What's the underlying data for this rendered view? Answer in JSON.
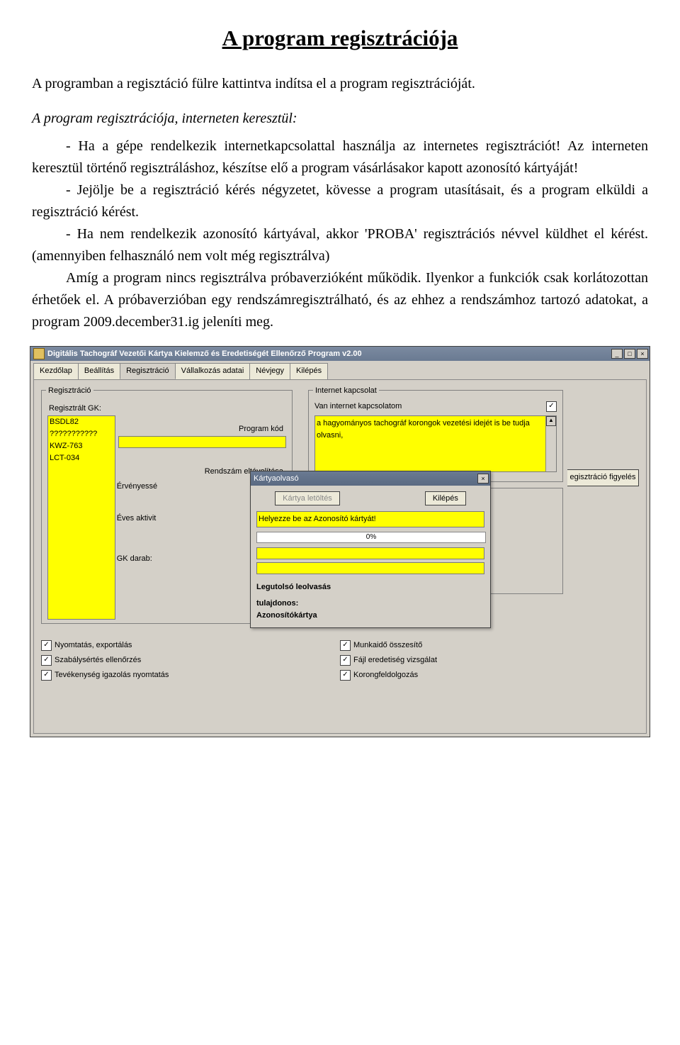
{
  "doc": {
    "title": "A program regisztrációja",
    "intro": "A programban a regisztáció fülre kattintva indítsa el a program regisztrációját.",
    "subTitle": "A program regisztrációja, interneten keresztül:",
    "p1": "- Ha a gépe rendelkezik internetkapcsolattal használja az internetes regisztrációt! Az interneten keresztül történő regisztráláshoz, készítse elő a program vásárlásakor kapott azonosító kártyáját!",
    "p2": "- Jejölje be a regisztráció kérés négyzetet, kövesse a program utasításait, és a program elküldi a regisztráció kérést.",
    "p3": "- Ha nem rendelkezik azonosító kártyával, akkor 'PROBA' regisztrációs névvel küldhet el kérést. (amennyiben felhasználó nem volt még regisztrálva)",
    "p4": "Amíg a program nincs regisztrálva próbaverzióként működik. Ilyenkor a funkciók csak korlátozottan érhetőek el. A próbaverzióban egy rendszámregisztrálható, és az ehhez a rendszámhoz tartozó adatokat, a program 2009.december31.ig jeleníti meg."
  },
  "window": {
    "title": "Digitális Tachográf Vezetői Kártya Kielemző és Eredetiségét Ellenőrző Program  v2.00",
    "tabs": [
      "Kezdőlap",
      "Beállítás",
      "Regisztráció",
      "Vállalkozás adatai",
      "Névjegy",
      "Kilépés"
    ],
    "activeTab": 2,
    "regBox": {
      "legend": "Regisztráció",
      "label1": "Regisztrált GK:",
      "listItems": [
        "BSDL82",
        "???????????",
        "KWZ-763",
        "LCT-034"
      ],
      "labProgramCode": "Program kód",
      "labRemovePlate": "Rendszám eltávolítása",
      "labValidate": "Érvényessé",
      "labActivation": "Éves aktivit",
      "labGkCount": "GK darab:"
    },
    "netBox": {
      "legend": "Internet kapcsolat",
      "hasInternet": "Van internet kapcsolatom",
      "textArea": "a hagyományos tachográf korongok vezetési idejét is be tudja olvasni,"
    },
    "peekButton": "egisztráció figyelés",
    "checksLeft": [
      "Nyomtatás, exportálás",
      "Szabálysértés ellenőrzés",
      "Tevékenység igazolás nyomtatás"
    ],
    "checksRight": [
      "Munkaidő összesítő",
      "Fájl eredetiség vizsgálat",
      "Korongfeldolgozás"
    ]
  },
  "modal": {
    "title": "Kártyaolvasó",
    "btnDownload": "Kártya letöltés",
    "btnExit": "Kilépés",
    "hint": "Helyezze be az Azonosító kártyát!",
    "progress": "0%",
    "line1": "Legutolsó leolvasás",
    "line2": "tulajdonos:",
    "line3": "Azonosítókártya"
  }
}
